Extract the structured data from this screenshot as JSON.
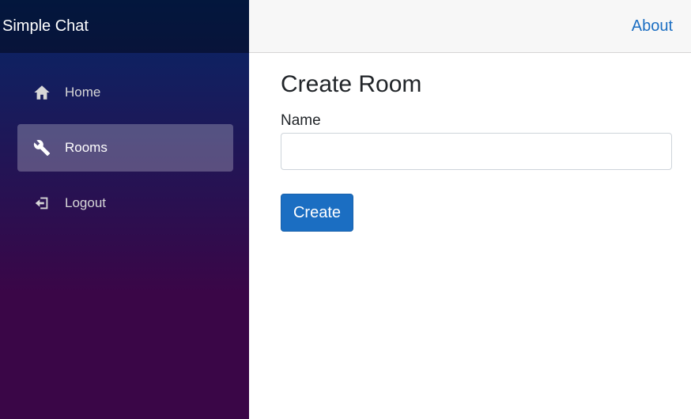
{
  "app": {
    "title": "Simple Chat"
  },
  "topbar": {
    "about_label": "About"
  },
  "sidebar": {
    "items": [
      {
        "label": "Home",
        "icon": "home-icon",
        "active": false
      },
      {
        "label": "Rooms",
        "icon": "wrench-icon",
        "active": true
      },
      {
        "label": "Logout",
        "icon": "logout-icon",
        "active": false
      }
    ]
  },
  "form": {
    "title": "Create Room",
    "name_label": "Name",
    "name_value": "",
    "name_placeholder": "",
    "submit_label": "Create"
  },
  "colors": {
    "accent": "#1b6ec2",
    "sidebar_top": "#052767",
    "sidebar_bottom": "#3a0647",
    "active_item_bg": "rgba(255,255,255,0.25)"
  }
}
